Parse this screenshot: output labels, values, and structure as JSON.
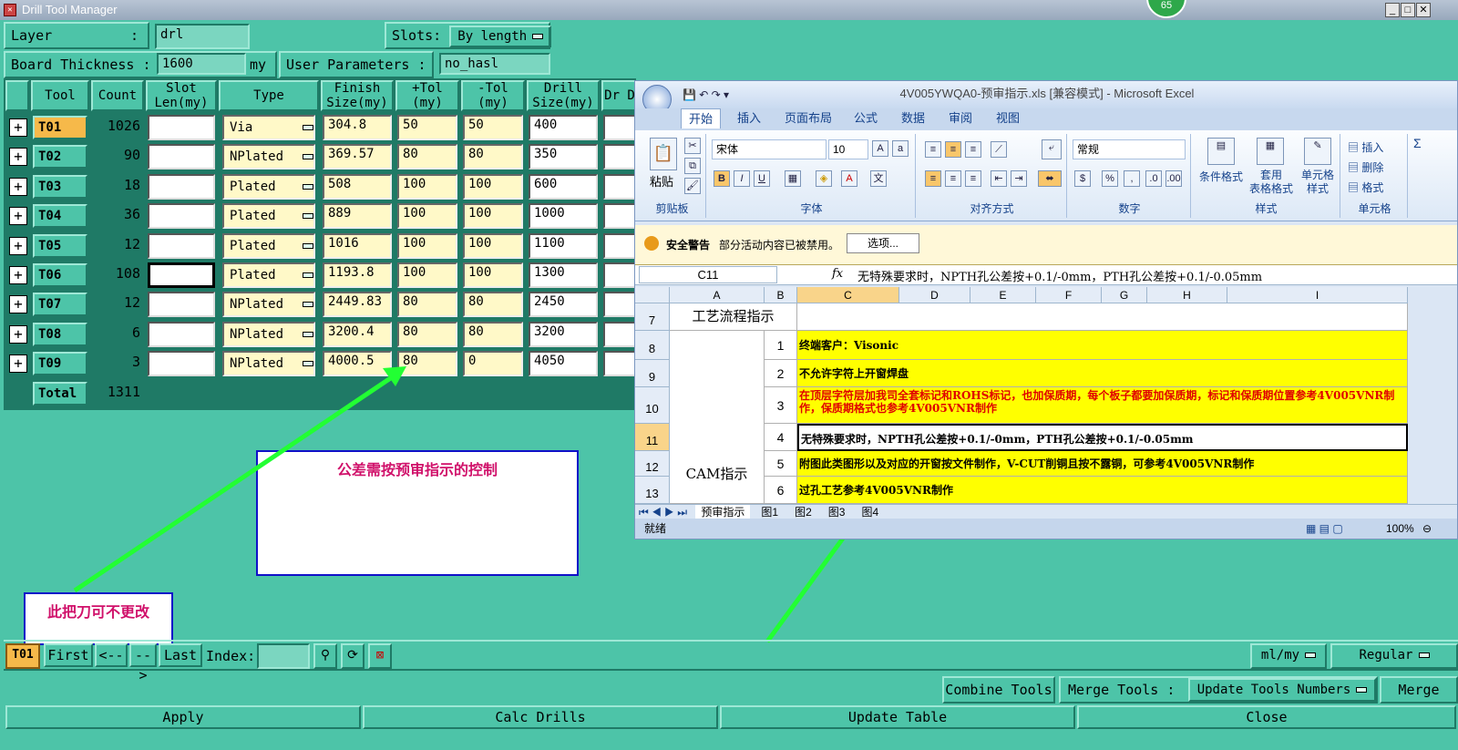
{
  "window": {
    "title": "Drill Tool Manager",
    "badge": "65"
  },
  "params": {
    "layer_label": "Layer",
    "layer_colon": ":",
    "layer_value": "drl",
    "slots_label": "Slots:",
    "slots_value": "By length",
    "thickness_label": "Board Thickness :",
    "thickness_value": "1600",
    "thickness_unit": "my",
    "user_params_label": "User Parameters :",
    "user_params_value": "no_hasl"
  },
  "columns": [
    "Tool",
    "Count",
    "Slot Len(my)",
    "Type",
    "Finish Size(my)",
    "+Tol (my)",
    "-Tol (my)",
    "Drill Size(my)",
    "Dr D"
  ],
  "rows": [
    {
      "tool": "T01",
      "count": "1026",
      "slot": "",
      "type": "Via",
      "finish": "304.8",
      "ptol": "50",
      "ntol": "50",
      "drill": "400"
    },
    {
      "tool": "T02",
      "count": "90",
      "slot": "",
      "type": "NPlated",
      "finish": "369.57",
      "ptol": "80",
      "ntol": "80",
      "drill": "350"
    },
    {
      "tool": "T03",
      "count": "18",
      "slot": "",
      "type": "Plated",
      "finish": "508",
      "ptol": "100",
      "ntol": "100",
      "drill": "600"
    },
    {
      "tool": "T04",
      "count": "36",
      "slot": "",
      "type": "Plated",
      "finish": "889",
      "ptol": "100",
      "ntol": "100",
      "drill": "1000"
    },
    {
      "tool": "T05",
      "count": "12",
      "slot": "",
      "type": "Plated",
      "finish": "1016",
      "ptol": "100",
      "ntol": "100",
      "drill": "1100"
    },
    {
      "tool": "T06",
      "count": "108",
      "slot": "",
      "type": "Plated",
      "finish": "1193.8",
      "ptol": "100",
      "ntol": "100",
      "drill": "1300"
    },
    {
      "tool": "T07",
      "count": "12",
      "slot": "",
      "type": "NPlated",
      "finish": "2449.83",
      "ptol": "80",
      "ntol": "80",
      "drill": "2450"
    },
    {
      "tool": "T08",
      "count": "6",
      "slot": "",
      "type": "NPlated",
      "finish": "3200.4",
      "ptol": "80",
      "ntol": "80",
      "drill": "3200"
    },
    {
      "tool": "T09",
      "count": "3",
      "slot": "",
      "type": "NPlated",
      "finish": "4000.5",
      "ptol": "80",
      "ntol": "0",
      "drill": "4050"
    }
  ],
  "total": {
    "label": "Total",
    "count": "1311"
  },
  "annotations": {
    "tolerance_note": "公差需按预审指示的控制",
    "tool_note": "此把刀可不更改"
  },
  "nav": {
    "current": "T01",
    "first": "First",
    "prev": "<--",
    "next": "-->",
    "last": "Last",
    "index_label": "Index:",
    "units": "ml/my",
    "mode": "Regular"
  },
  "actions": {
    "combine": "Combine Tools",
    "merge_label": "Merge Tools :",
    "update_numbers": "Update Tools Numbers",
    "merge": "Merge",
    "apply": "Apply",
    "calc": "Calc Drills",
    "update_table": "Update Table",
    "close": "Close"
  },
  "excel": {
    "title": "4V005YWQA0-预审指示.xls  [兼容模式] - Microsoft Excel",
    "tabs": [
      "开始",
      "插入",
      "页面布局",
      "公式",
      "数据",
      "审阅",
      "视图"
    ],
    "paste": "粘贴",
    "clipboard": "剪贴板",
    "font_name": "宋体",
    "font_size": "10",
    "font_group": "字体",
    "align_group": "对齐方式",
    "number_format": "常规",
    "number_group": "数字",
    "cond_format": "条件格式",
    "table_format": "套用\n表格格式",
    "cell_style": "单元格\n样式",
    "style_group": "样式",
    "insert": "插入",
    "delete": "删除",
    "format": "格式",
    "cells_group": "单元格",
    "security_label": "安全警告",
    "security_msg": "部分活动内容已被禁用。",
    "options": "选项...",
    "cell_ref": "C11",
    "fx": "fx",
    "formula": "无特殊要求时，NPTH孔公差按+0.1/-0mm，PTH孔公差按+0.1/-0.05mm",
    "col_headers": [
      "A",
      "B",
      "C",
      "D",
      "E",
      "F",
      "G",
      "H",
      "I"
    ],
    "row_headers": [
      "7",
      "8",
      "9",
      "10",
      "11",
      "12",
      "13"
    ],
    "section1": "工艺流程指示",
    "section2": "CAM指示",
    "items": [
      {
        "n": "1",
        "text": "终端客户：Visonic",
        "red": false
      },
      {
        "n": "2",
        "text": "不允许字符上开窗焊盘",
        "red": false
      },
      {
        "n": "3",
        "text": "在顶层字符层加我司全套标记和ROHS标记，也加保质期，每个板子都要加保质期，标记和保质期位置参考4V005VNR制作，保质期格式也参考4V005VNR制作",
        "red": true
      },
      {
        "n": "4",
        "text": "无特殊要求时，NPTH孔公差按+0.1/-0mm，PTH孔公差按+0.1/-0.05mm",
        "red": false
      },
      {
        "n": "5",
        "text": "附图此类图形以及对应的开窗按文件制作，V-CUT削铜且按不露铜，可参考4V005VNR制作",
        "red": false
      },
      {
        "n": "6",
        "text": "过孔工艺参考4V005VNR制作",
        "red": false
      }
    ],
    "sheets": [
      "预审指示",
      "图1",
      "图2",
      "图3",
      "图4"
    ],
    "status": "就绪",
    "zoom": "100%"
  }
}
